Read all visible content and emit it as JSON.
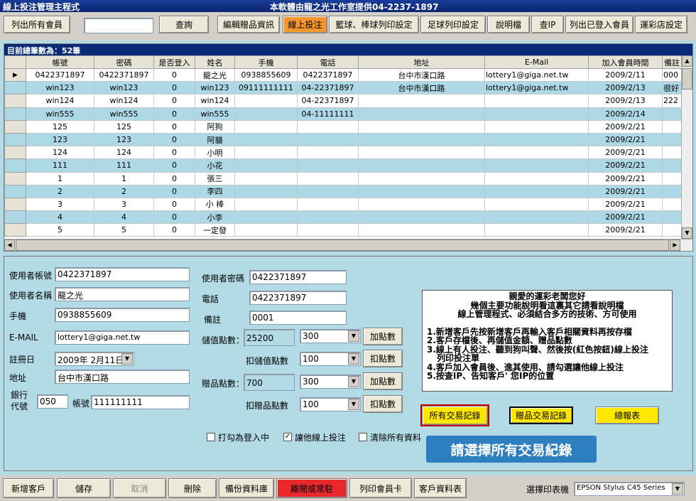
{
  "window": {
    "title": "線上投注管理主程式",
    "provider": "本軟體由龍之光工作室提供04-2237-1897"
  },
  "toolbar": {
    "list_all": "列出所有會員",
    "search_value": "",
    "query": "查詢",
    "edit_gifts": "編輯贈品資訊",
    "online_bet": "線上投注",
    "basket_print": "籃球、棒球列印設定",
    "soccer_print": "足球列印設定",
    "manual": "說明檔",
    "check_ip": "查IP",
    "list_logged": "列出已登入會員",
    "lottery_settings": "運彩店設定"
  },
  "grid": {
    "record_count": "目前總筆數為：52筆",
    "columns": [
      "帳號",
      "密碼",
      "是否登入",
      "姓名",
      "手機",
      "電話",
      "地址",
      "E-Mail",
      "加入會員時間",
      "備註"
    ],
    "rows": [
      [
        "0422371897",
        "0422371897",
        "0",
        "龍之光",
        "0938855609",
        "0422371897",
        "台中市漢口路",
        "lottery1@giga.net.tw",
        "2009/2/11",
        "000"
      ],
      [
        "win123",
        "win123",
        "0",
        "win123",
        "09111111111",
        "04-22371897",
        "台中市漢口路",
        "lottery1@giga.net.tw",
        "2009/2/13",
        "很好"
      ],
      [
        "win124",
        "win124",
        "0",
        "win124",
        "",
        "04-22371897",
        "",
        "",
        "2009/2/13",
        "222"
      ],
      [
        "win555",
        "win555",
        "0",
        "win555",
        "",
        "04-11111111",
        "",
        "",
        "2009/2/14",
        ""
      ],
      [
        "125",
        "125",
        "0",
        "阿狗",
        "",
        "",
        "",
        "",
        "2009/2/21",
        ""
      ],
      [
        "123",
        "123",
        "0",
        "阿貓",
        "",
        "",
        "",
        "",
        "2009/2/21",
        ""
      ],
      [
        "124",
        "124",
        "0",
        "小明",
        "",
        "",
        "",
        "",
        "2009/2/21",
        ""
      ],
      [
        "111",
        "111",
        "0",
        "小花",
        "",
        "",
        "",
        "",
        "2009/2/21",
        ""
      ],
      [
        "1",
        "1",
        "0",
        "張三",
        "",
        "",
        "",
        "",
        "2009/2/21",
        ""
      ],
      [
        "2",
        "2",
        "0",
        "李四",
        "",
        "",
        "",
        "",
        "2009/2/21",
        ""
      ],
      [
        "3",
        "3",
        "0",
        "小 棒",
        "",
        "",
        "",
        "",
        "2009/2/21",
        ""
      ],
      [
        "4",
        "4",
        "0",
        "小李",
        "",
        "",
        "",
        "",
        "2009/2/21",
        ""
      ],
      [
        "5",
        "5",
        "0",
        "一定發",
        "",
        "",
        "",
        "",
        "2009/2/21",
        ""
      ]
    ]
  },
  "form": {
    "account_label": "使用者帳號",
    "account": "0422371897",
    "name_label": "使用者名稱",
    "name": "龍之光",
    "mobile_label": "手機",
    "mobile": "0938855609",
    "email_label": "E-MAIL",
    "email": "lottery1@giga.net.tw",
    "reg_label": "註冊日",
    "reg_date": "2009年 2月11日",
    "addr_label": "地址",
    "addr": "台中市漢口路",
    "bank_label1": "銀行",
    "bank_label2": "代號",
    "bank_code": "050",
    "acct_label": "帳號",
    "bank_acct": "111111111",
    "pwd_label": "使用者密碼",
    "pwd": "0422371897",
    "phone_label": "電話",
    "phone": "0422371897",
    "note_label": "備註",
    "note": "0001",
    "stored_label": "儲值點數：",
    "stored": "25200",
    "stored_amt": "300",
    "add_points": "加點數",
    "stored_deduct_label": "扣儲值點數",
    "stored_deduct": "100",
    "deduct_points": "扣點數",
    "gift_label": "贈品點數：",
    "gift": "700",
    "gift_amt": "300",
    "add_gift": "加點數",
    "gift_deduct_label": "扣贈品點數",
    "gift_deduct": "100",
    "deduct_gift": "扣點數",
    "cb_login": "打勾為登入中",
    "cb_allow": "讓他線上投注",
    "cb_clear": "清除所有資料"
  },
  "info": {
    "l1": "親愛的運彩老闆您好",
    "l2": "幾個主要功能說明看這裏其它請看說明檔",
    "l3": "線上管理程式、必須結合多方的技術、方可使用",
    "l4": "1.新增客戶先按新增客戶再輸入客戶相關資料再按存檔",
    "l5": "2.客戶存檔後、再儲值金額、贈品點數",
    "l6": "3.線上有人投注、聽到狗叫聲、然後按(紅色按鈕)線上投注",
    "l7": "列印投注單",
    "l8": "4.客戶加入會員後、進其使用、請勾選讓他線上投注",
    "l9": "5.按查IP、告知客戶' 您IP的位置"
  },
  "actions": {
    "all_tx": "所有交易記錄",
    "gift_tx": "贈品交易記錄",
    "report": "總報表"
  },
  "hint": "請選擇所有交易紀錄",
  "bottom": {
    "new": "新增客戶",
    "save": "儲存",
    "cancel": "取消",
    "delete": "刪除",
    "backup": "備份資料庫",
    "exit": "離開或常駐",
    "print_card": "列印會員卡",
    "customer_sheet": "客戶資料表",
    "printer_label": "選擇印表機",
    "printer": "EPSON Stylus C45 Series"
  }
}
